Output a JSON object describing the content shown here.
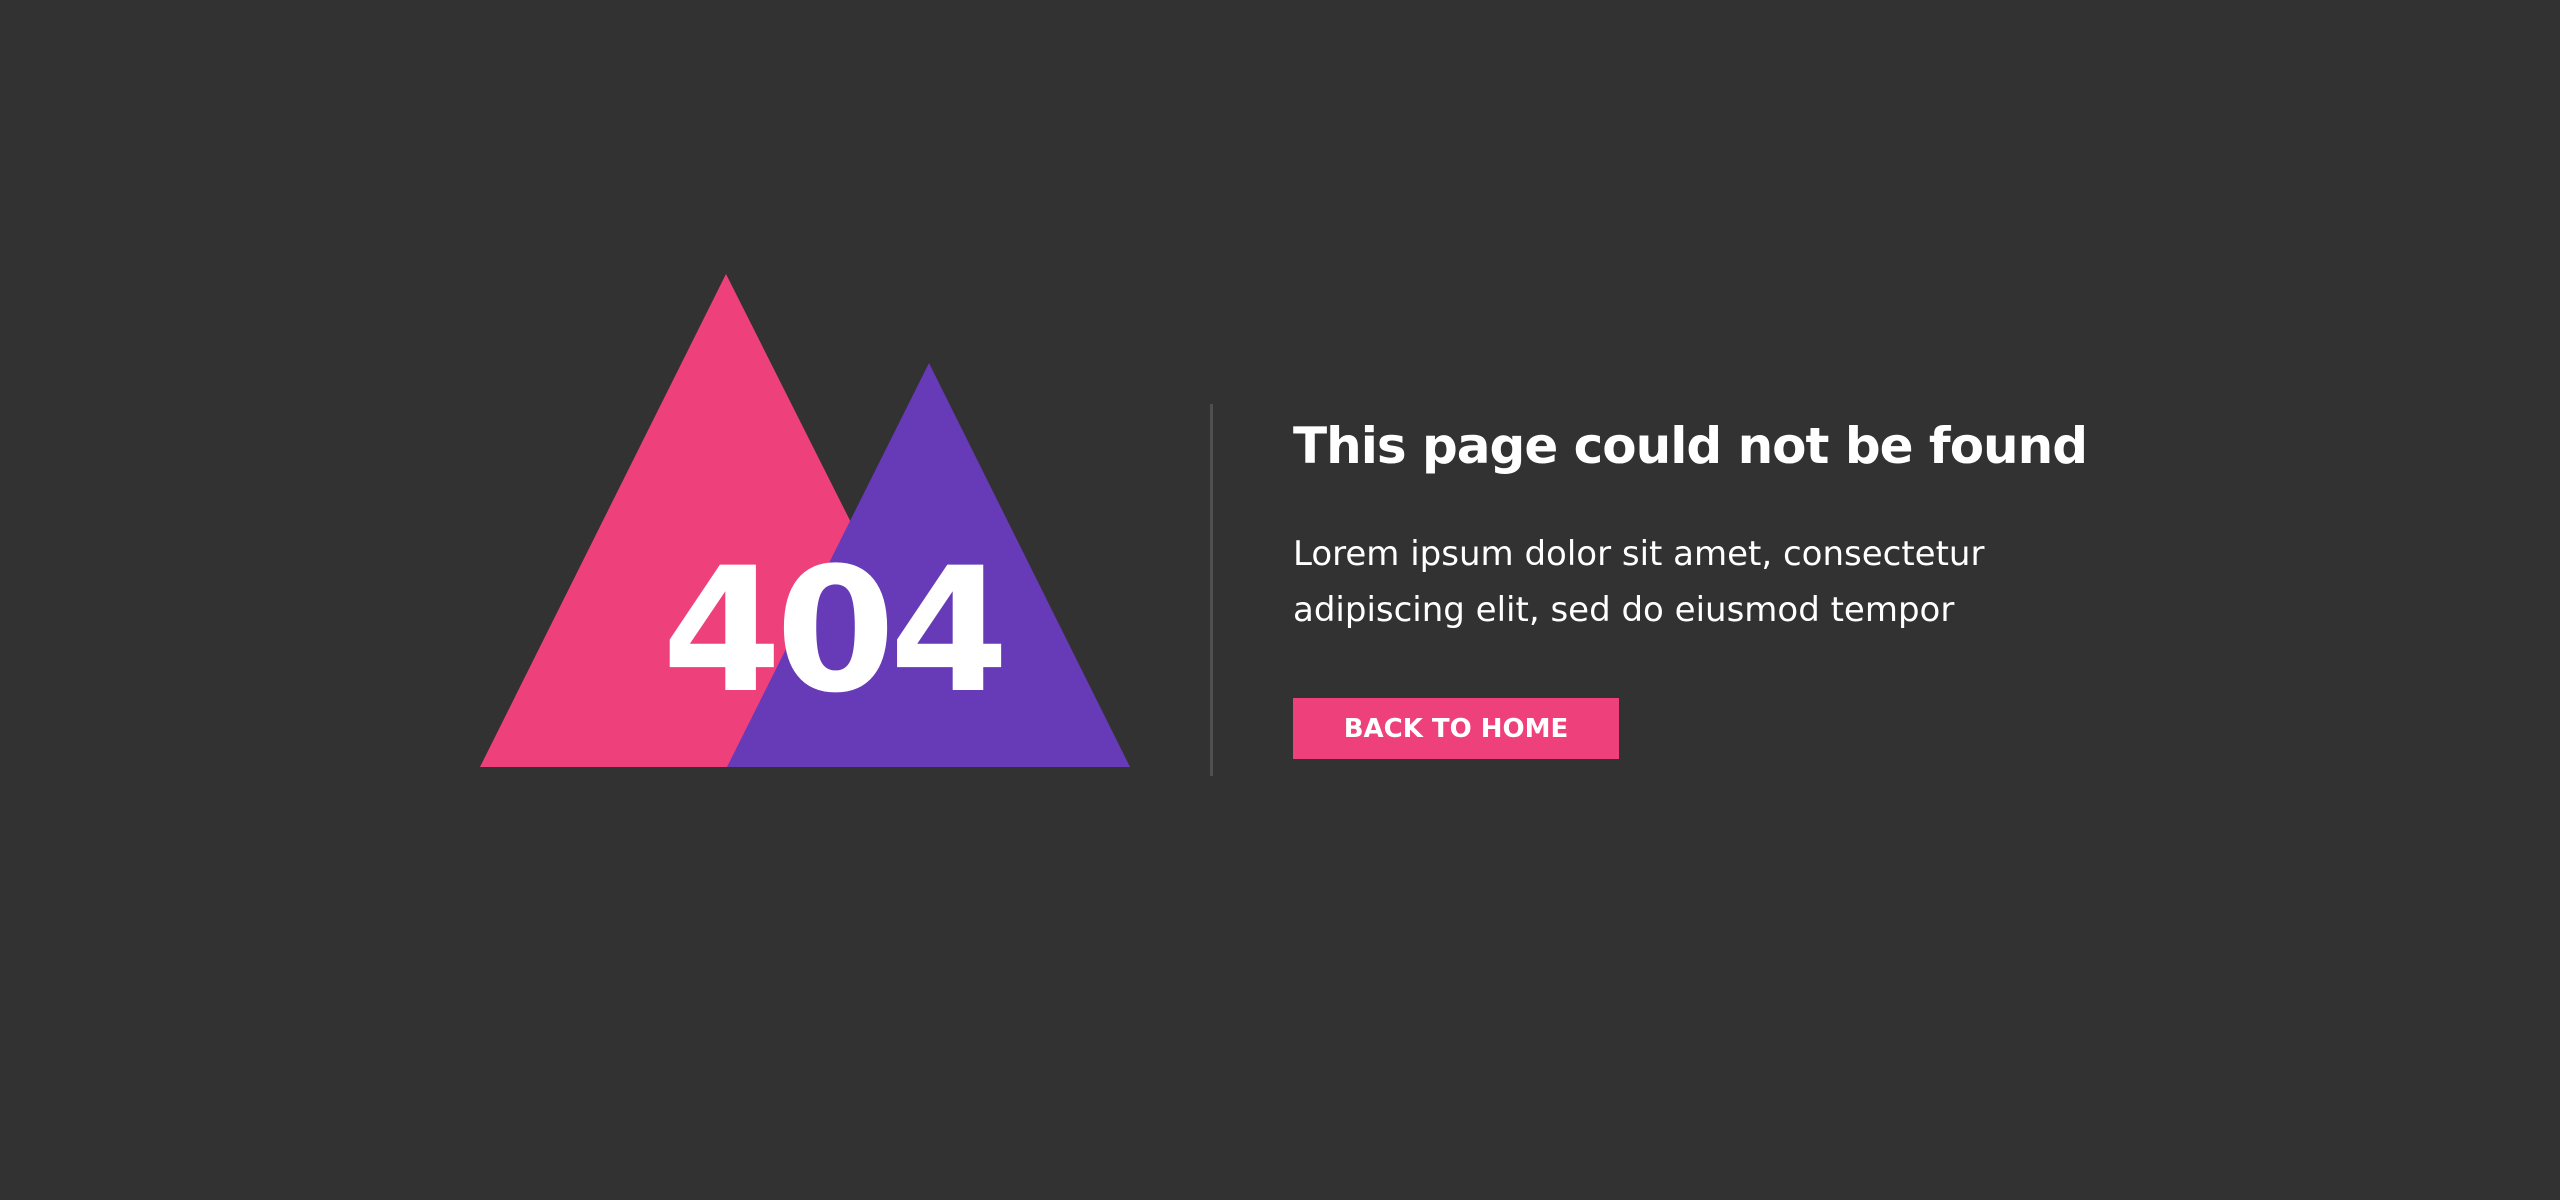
{
  "error": {
    "code": "404",
    "title": "This page could not be found",
    "description": "Lorem ipsum dolor sit amet, consectetur adipiscing elit, sed do eiusmod tempor",
    "button_label": "BACK TO HOME"
  },
  "colors": {
    "background": "#323232",
    "accent_pink": "#ee417b",
    "accent_purple": "#673ab7",
    "divider": "#4f4f4f",
    "text": "#ffffff"
  }
}
